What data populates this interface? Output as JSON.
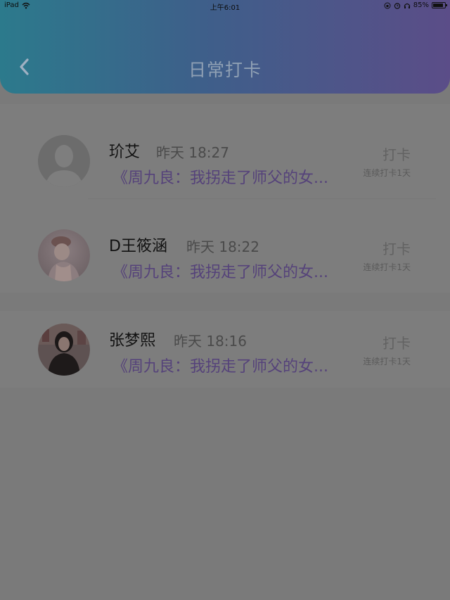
{
  "status_bar": {
    "device": "iPad",
    "time": "上午6:01",
    "battery": "85%",
    "battery_level": 0.85
  },
  "header": {
    "title": "日常打卡",
    "back_icon": "chevron-left-icon",
    "gradient_colors": [
      "#2c7a8c",
      "#5b4d88"
    ]
  },
  "checkins": [
    {
      "name": "玠艾",
      "time": "昨天 18:27",
      "book": "《周九良：我拐走了师父的女...",
      "action": "打卡",
      "streak": "连续打卡1天",
      "avatar": "default-avatar"
    },
    {
      "name": "D王筱涵",
      "time": "昨天 18:22",
      "book": "《周九良：我拐走了师父的女...",
      "action": "打卡",
      "streak": "连续打卡1天",
      "avatar": "photo-avatar"
    },
    {
      "name": "张梦熙",
      "time": "昨天 18:16",
      "book": "《周九良：我拐走了师父的女...",
      "action": "打卡",
      "streak": "连续打卡1天",
      "avatar": "photo-avatar"
    }
  ]
}
